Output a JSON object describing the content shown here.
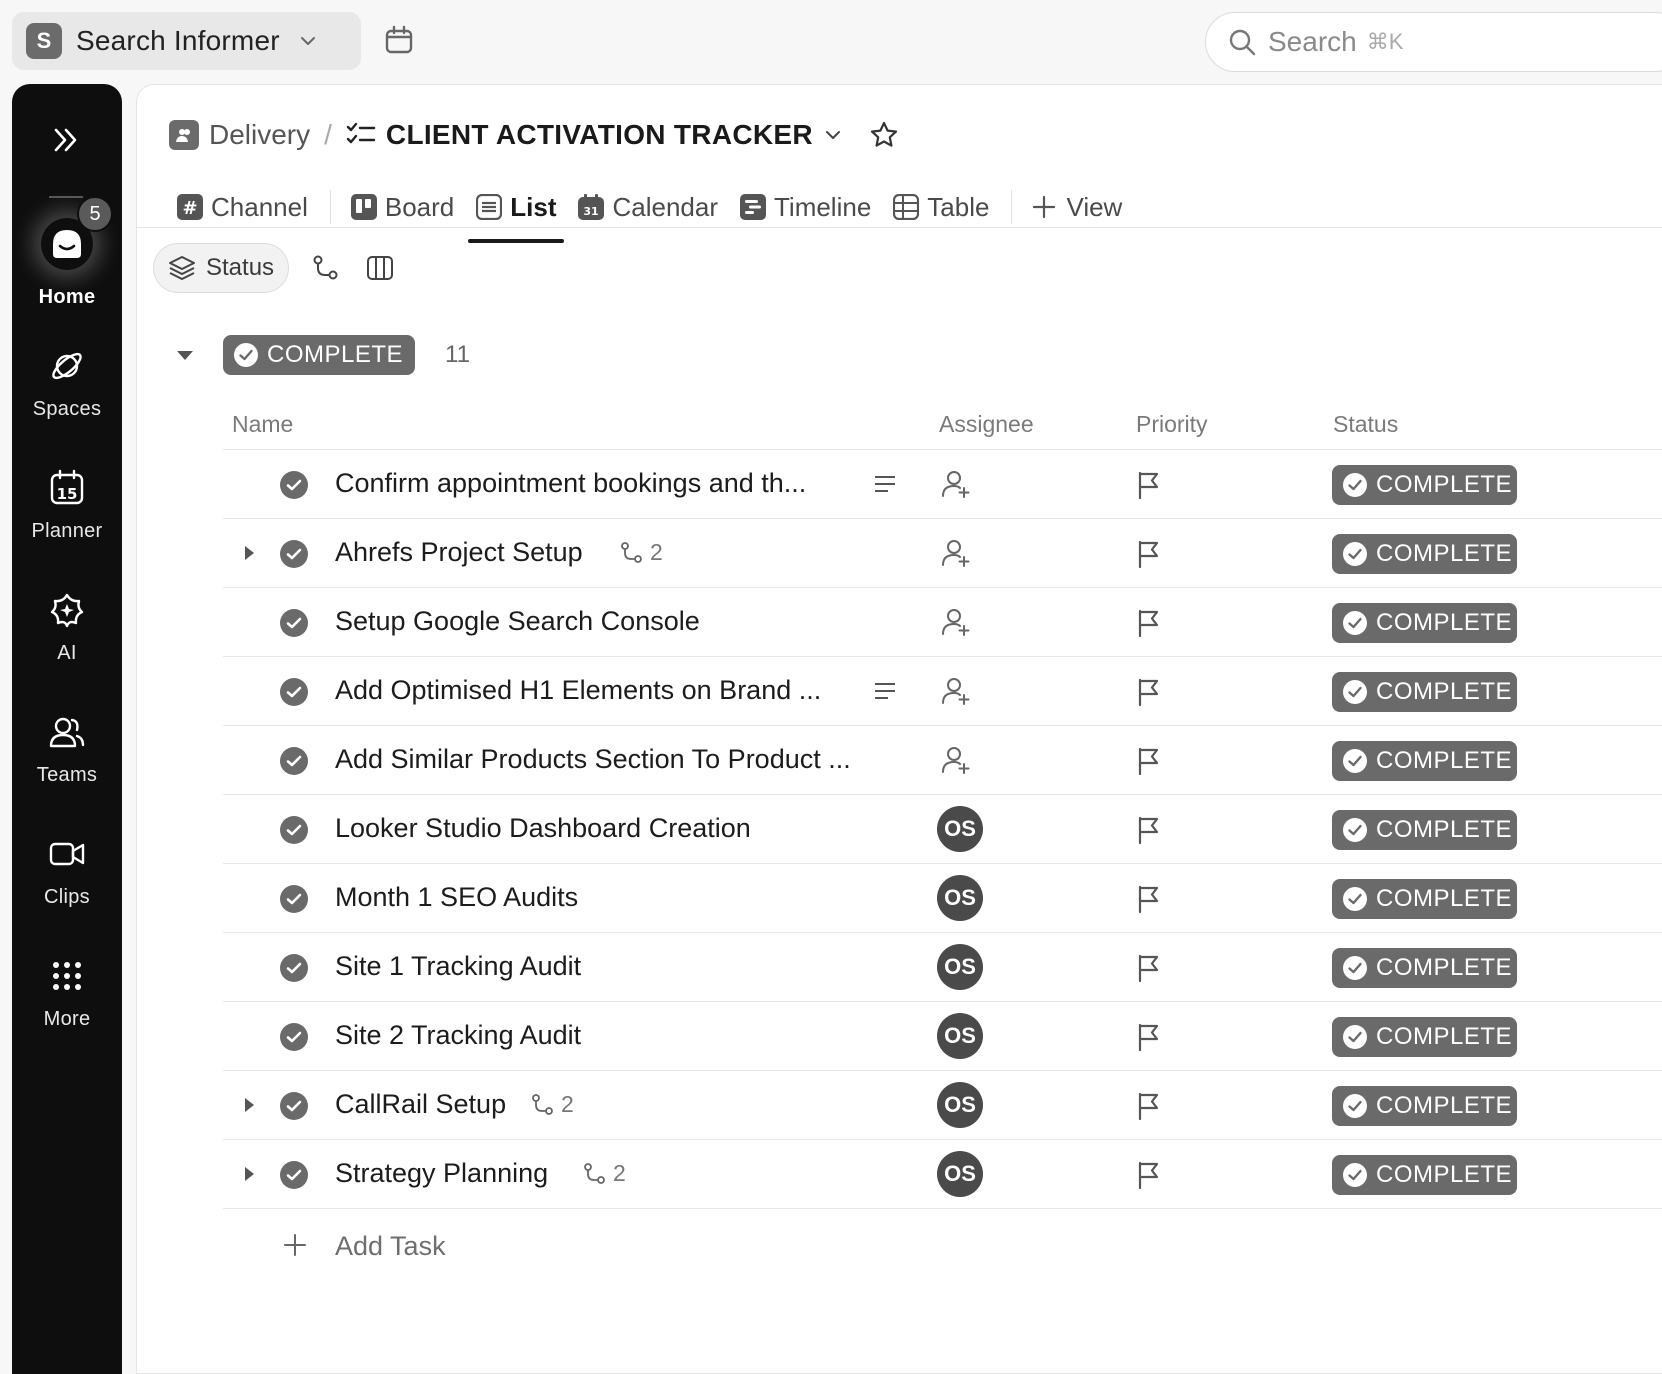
{
  "workspace": {
    "initial": "S",
    "name": "Search Informer"
  },
  "search": {
    "placeholder": "Search",
    "shortcut": "⌘K"
  },
  "rail": {
    "items": [
      {
        "label": "Home",
        "badge": "5"
      },
      {
        "label": "Spaces"
      },
      {
        "label": "Planner"
      },
      {
        "label": "AI"
      },
      {
        "label": "Teams"
      },
      {
        "label": "Clips"
      },
      {
        "label": "More"
      }
    ]
  },
  "breadcrumb": {
    "space": "Delivery",
    "separator": "/",
    "list": "CLIENT ACTIVATION TRACKER"
  },
  "tabs": [
    {
      "label": "Channel"
    },
    {
      "label": "Board"
    },
    {
      "label": "List"
    },
    {
      "label": "Calendar"
    },
    {
      "label": "Timeline"
    },
    {
      "label": "Table"
    }
  ],
  "add_view": {
    "label": "View"
  },
  "filters": {
    "status_label": "Status"
  },
  "group": {
    "label": "COMPLETE",
    "count": "11"
  },
  "columns": {
    "name": "Name",
    "assignee": "Assignee",
    "priority": "Priority",
    "status": "Status"
  },
  "tasks": [
    {
      "name": "Confirm appointment bookings and th...",
      "assignee": "",
      "status": "COMPLETE"
    },
    {
      "name": "Ahrefs Project Setup",
      "subtasks": "2",
      "assignee": "",
      "status": "COMPLETE"
    },
    {
      "name": "Setup Google Search Console",
      "assignee": "",
      "status": "COMPLETE"
    },
    {
      "name": "Add Optimised H1 Elements on Brand ...",
      "assignee": "",
      "status": "COMPLETE"
    },
    {
      "name": "Add Similar Products Section To Product ...",
      "assignee": "",
      "status": "COMPLETE"
    },
    {
      "name": "Looker Studio Dashboard Creation",
      "assignee": "OS",
      "status": "COMPLETE"
    },
    {
      "name": "Month 1 SEO Audits",
      "assignee": "OS",
      "status": "COMPLETE"
    },
    {
      "name": "Site 1 Tracking Audit",
      "assignee": "OS",
      "status": "COMPLETE"
    },
    {
      "name": "Site 2 Tracking Audit",
      "assignee": "OS",
      "status": "COMPLETE"
    },
    {
      "name": "CallRail Setup",
      "subtasks": "2",
      "assignee": "OS",
      "status": "COMPLETE"
    },
    {
      "name": "Strategy Planning",
      "subtasks": "2",
      "assignee": "OS",
      "status": "COMPLETE"
    }
  ],
  "add_task": {
    "label": "Add Task"
  },
  "colors": {
    "rail_bg": "#0e0e0e",
    "status_complete": "#6a6a6a",
    "avatar_bg": "#4a4a4a"
  }
}
